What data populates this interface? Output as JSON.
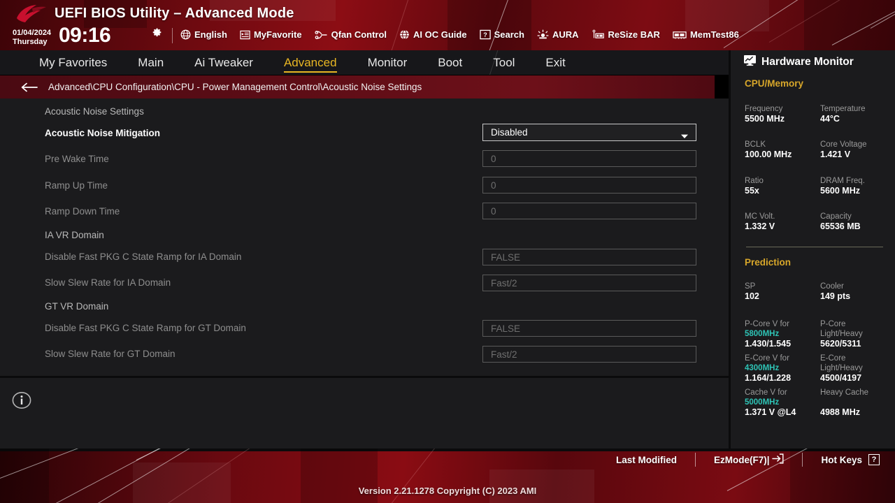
{
  "header": {
    "title": "UEFI BIOS Utility – Advanced Mode",
    "logo_name": "rog-logo",
    "date": "01/04/2024",
    "weekday": "Thursday",
    "time": "09:16",
    "gear_icon": "gear-icon",
    "tools": [
      {
        "label": "English",
        "icon": "globe-icon"
      },
      {
        "label": "MyFavorite",
        "icon": "star-list-icon"
      },
      {
        "label": "Qfan Control",
        "icon": "fan-icon"
      },
      {
        "label": "AI OC Guide",
        "icon": "globe-icon"
      },
      {
        "label": "Search",
        "icon": "question-box-icon"
      },
      {
        "label": "AURA",
        "icon": "aura-light-icon"
      },
      {
        "label": "ReSize BAR",
        "icon": "resize-bar-icon"
      },
      {
        "label": "MemTest86",
        "icon": "memtest-icon"
      }
    ]
  },
  "menu": {
    "items": [
      {
        "label": "My Favorites",
        "active": false
      },
      {
        "label": "Main",
        "active": false
      },
      {
        "label": "Ai Tweaker",
        "active": false
      },
      {
        "label": "Advanced",
        "active": true
      },
      {
        "label": "Monitor",
        "active": false
      },
      {
        "label": "Boot",
        "active": false
      },
      {
        "label": "Tool",
        "active": false
      },
      {
        "label": "Exit",
        "active": false
      }
    ]
  },
  "breadcrumb": {
    "back_icon": "back-arrow-icon",
    "path": "Advanced\\CPU Configuration\\CPU - Power Management Control\\Acoustic Noise Settings"
  },
  "content": {
    "rows": [
      {
        "kind": "header",
        "label": "Acoustic Noise Settings"
      },
      {
        "kind": "combo",
        "label": "Acoustic Noise Mitigation",
        "value": "Disabled"
      },
      {
        "kind": "field-dim",
        "label": "Pre Wake Time",
        "value": "0"
      },
      {
        "kind": "field-dim",
        "label": "Ramp Up Time",
        "value": "0"
      },
      {
        "kind": "field-dim",
        "label": "Ramp Down Time",
        "value": "0"
      },
      {
        "kind": "header",
        "label": "IA VR Domain"
      },
      {
        "kind": "field-dim",
        "label": "Disable Fast PKG C State Ramp for IA Domain",
        "value": "FALSE"
      },
      {
        "kind": "field-dim",
        "label": "Slow Slew Rate for IA Domain",
        "value": "Fast/2"
      },
      {
        "kind": "header",
        "label": "GT VR Domain"
      },
      {
        "kind": "field-dim",
        "label": "Disable Fast PKG C State Ramp for GT Domain",
        "value": "FALSE"
      },
      {
        "kind": "field-dim",
        "label": "Slow Slew Rate for GT Domain",
        "value": "Fast/2"
      }
    ],
    "info_icon": "info-icon"
  },
  "sidebar": {
    "title": "Hardware Monitor",
    "title_icon": "monitor-chart-icon",
    "sections": [
      {
        "name": "CPU/Memory",
        "color": "#d8a72a"
      },
      {
        "name": "Prediction",
        "color": "#d8a72a"
      }
    ],
    "cpu_memory": [
      {
        "key": "Frequency",
        "value": "5500 MHz"
      },
      {
        "key": "Temperature",
        "value": "44°C"
      },
      {
        "key": "BCLK",
        "value": "100.00 MHz"
      },
      {
        "key": "Core Voltage",
        "value": "1.421 V"
      },
      {
        "key": "Ratio",
        "value": "55x"
      },
      {
        "key": "DRAM Freq.",
        "value": "5600 MHz"
      },
      {
        "key": "MC Volt.",
        "value": "1.332 V"
      },
      {
        "key": "Capacity",
        "value": "65536 MB"
      }
    ],
    "prediction": [
      {
        "key": "SP",
        "value": "102"
      },
      {
        "key": "Cooler",
        "value": "149 pts"
      }
    ],
    "prediction_detail": [
      {
        "key1": "P-Core V for",
        "key2": "5800MHz",
        "value": "1.430/1.545",
        "rkey1": "P-Core",
        "rkey2": "Light/Heavy",
        "rvalue": "5620/5311"
      },
      {
        "key1": "E-Core V for",
        "key2": "4300MHz",
        "value": "1.164/1.228",
        "rkey1": "E-Core",
        "rkey2": "Light/Heavy",
        "rvalue": "4500/4197"
      },
      {
        "key1": "Cache V for",
        "key2": "5000MHz",
        "value": "1.371 V @L4",
        "rkey1": "Heavy Cache",
        "rkey2": "",
        "rvalue": "4988 MHz"
      }
    ],
    "accent_teal": "#2ec4b6"
  },
  "footer": {
    "last_modified": "Last Modified",
    "ezmode": "EzMode(F7)|",
    "ezmode_icon": "arrow-into-box-icon",
    "hotkeys": "Hot Keys",
    "hotkeys_key": "?",
    "version": "Version 2.21.1278 Copyright (C) 2023 AMI"
  }
}
